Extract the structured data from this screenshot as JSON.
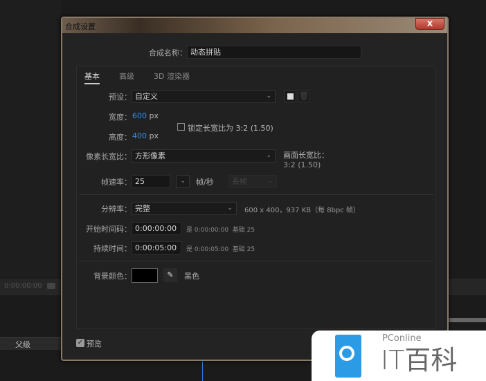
{
  "background": {
    "timecode": "0:00:00:00",
    "parent_label": "父级"
  },
  "dialog": {
    "title": "合成设置",
    "close": "X",
    "name_label": "合成名称：",
    "name_value": "动态拼贴",
    "tabs": [
      {
        "label": "基本",
        "active": true
      },
      {
        "label": "高级"
      },
      {
        "label": "3D 渲染器"
      }
    ],
    "preset_label": "预设：",
    "preset_value": "自定义",
    "width_label": "宽度：",
    "width_value": "600",
    "width_unit": "px",
    "height_label": "高度：",
    "height_value": "400",
    "height_unit": "px",
    "lock_label": "锁定长宽比为 3:2 (1.50)",
    "lock_checked": false,
    "par_label": "像素长宽比：",
    "par_value": "方形像素",
    "frame_aspect_label": "画面长宽比：",
    "frame_aspect_value": "3:2 (1.50)",
    "fps_label": "帧速率：",
    "fps_value": "25",
    "fps_unit": "帧/秒",
    "drop_value": "丢帧",
    "res_label": "分辨率：",
    "res_value": "完整",
    "res_info": "600 x 400，937 KB（每 8bpc 帧）",
    "start_label": "开始时间码：",
    "start_value": "0:00:00:00",
    "start_info": "是 0:00:00:00  基础 25",
    "dur_label": "持续时间：",
    "dur_value": "0:00:05:00",
    "dur_info": "是 0:00:05:00  基础 25",
    "bg_label": "背景颜色：",
    "bg_color": "#000000",
    "bg_name": "黑色",
    "preview_label": "预览",
    "preview_checked": true
  },
  "watermark": {
    "brand": "PConline",
    "name": "IT百科",
    "color": "#2c9be6"
  }
}
